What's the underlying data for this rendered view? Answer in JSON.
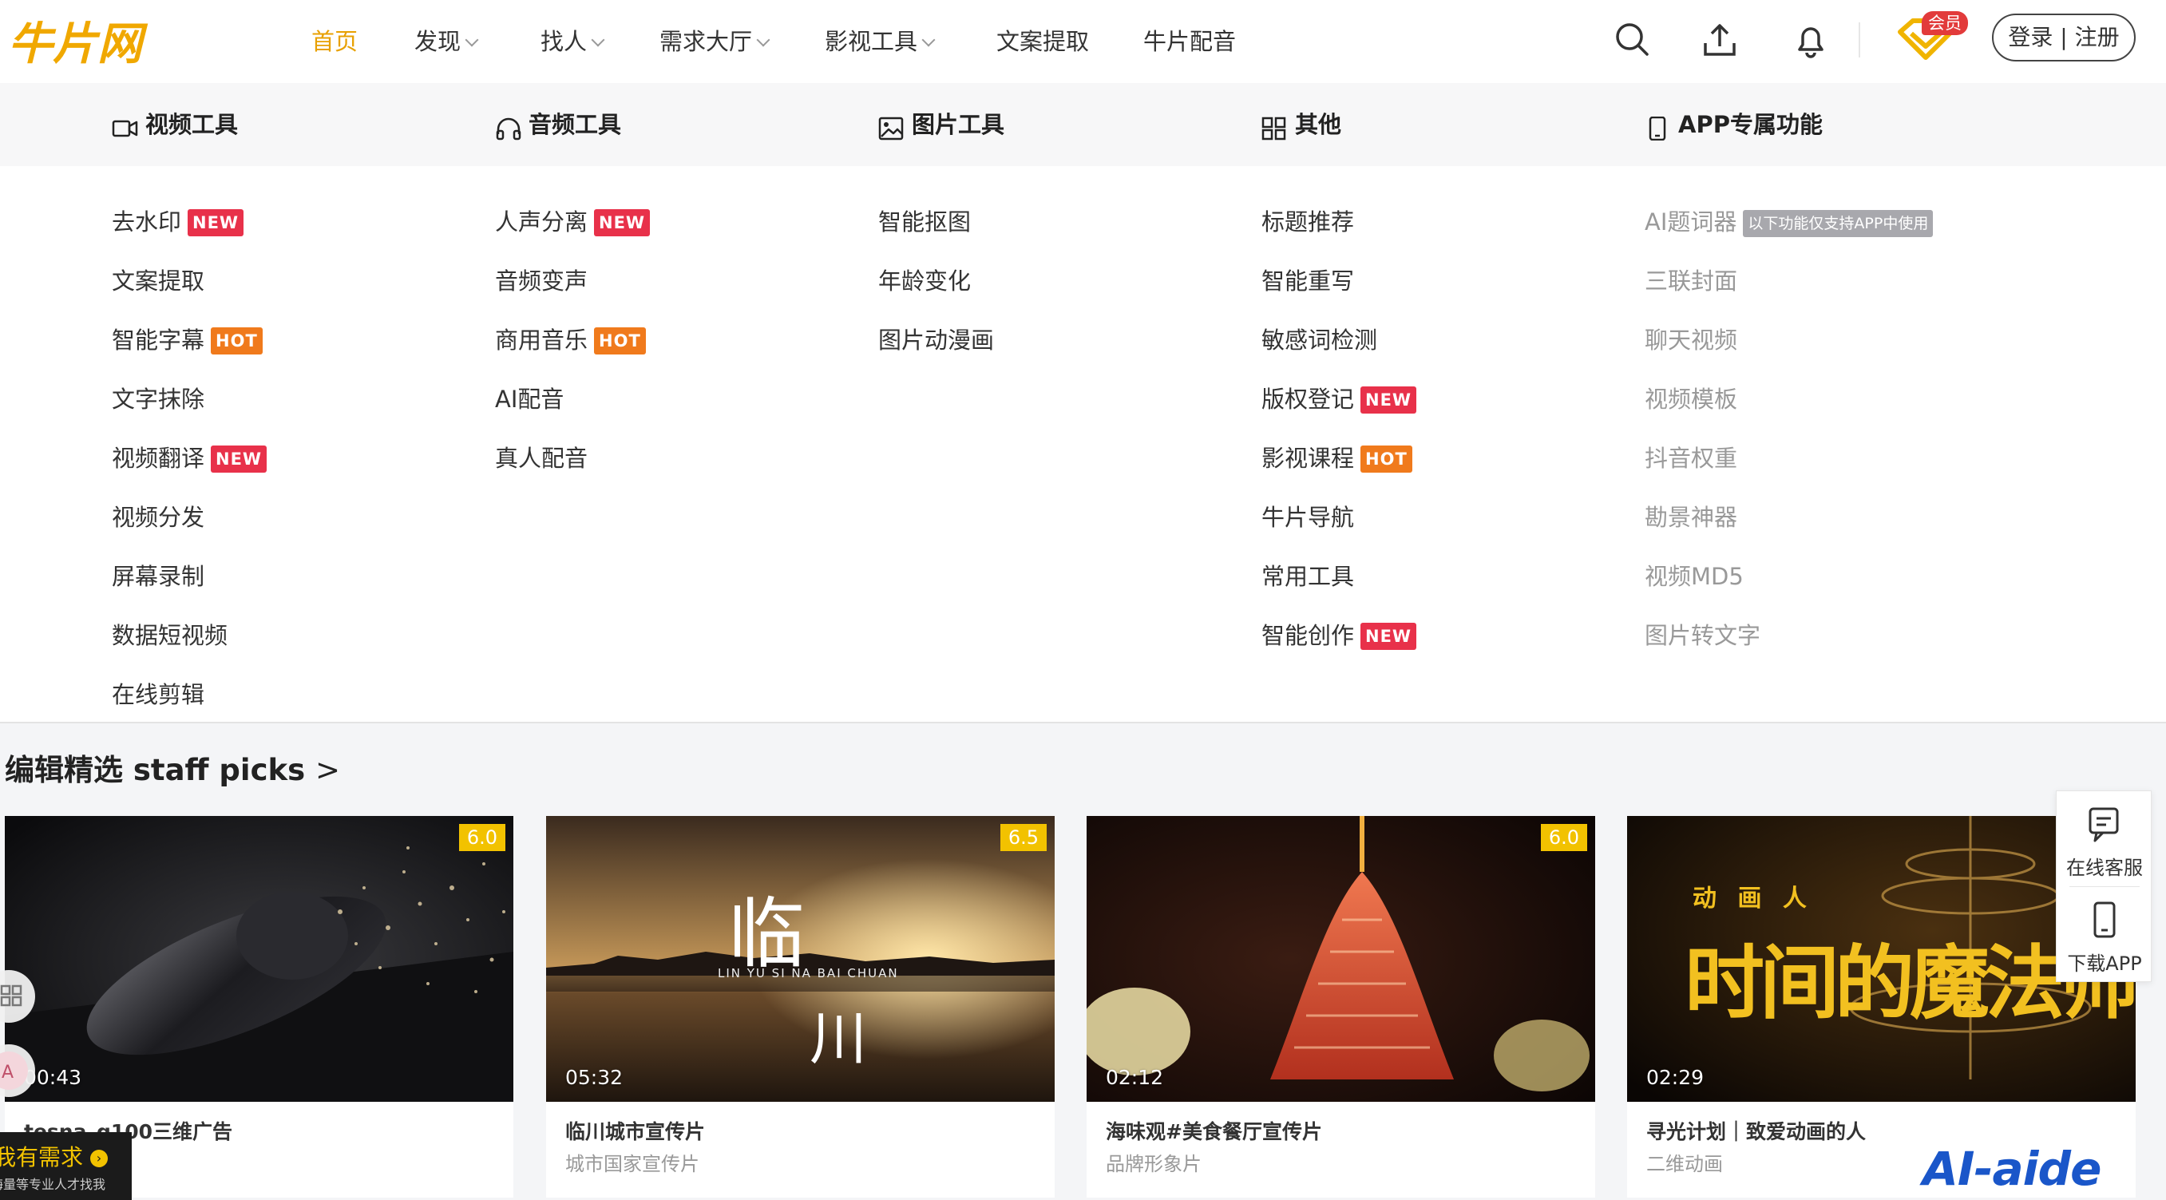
{
  "brand": {
    "logo_text": "牛片网",
    "accent": "#e8a000"
  },
  "nav": {
    "items": [
      {
        "label": "首页",
        "dropdown": false
      },
      {
        "label": "发现",
        "dropdown": true
      },
      {
        "label": "找人",
        "dropdown": true
      },
      {
        "label": "需求大厅",
        "dropdown": true
      },
      {
        "label": "影视工具",
        "dropdown": true
      },
      {
        "label": "文案提取",
        "dropdown": false
      },
      {
        "label": "牛片配音",
        "dropdown": false
      }
    ],
    "vip_badge": "会员",
    "login_label": "登录 | 注册"
  },
  "menu": {
    "columns": [
      {
        "title": "视频工具",
        "icon": "video-camera-icon",
        "items": [
          {
            "label": "去水印",
            "tag": "NEW"
          },
          {
            "label": "文案提取",
            "tag": ""
          },
          {
            "label": "智能字幕",
            "tag": "HOT"
          },
          {
            "label": "文字抹除",
            "tag": ""
          },
          {
            "label": "视频翻译",
            "tag": "NEW"
          },
          {
            "label": "视频分发",
            "tag": ""
          },
          {
            "label": "屏幕录制",
            "tag": ""
          },
          {
            "label": "数据短视频",
            "tag": ""
          },
          {
            "label": "在线剪辑",
            "tag": ""
          }
        ]
      },
      {
        "title": "音频工具",
        "icon": "headphones-icon",
        "items": [
          {
            "label": "人声分离",
            "tag": "NEW"
          },
          {
            "label": "音频变声",
            "tag": ""
          },
          {
            "label": "商用音乐",
            "tag": "HOT"
          },
          {
            "label": "AI配音",
            "tag": ""
          },
          {
            "label": "真人配音",
            "tag": ""
          }
        ]
      },
      {
        "title": "图片工具",
        "icon": "image-icon",
        "items": [
          {
            "label": "智能抠图",
            "tag": ""
          },
          {
            "label": "年龄变化",
            "tag": ""
          },
          {
            "label": "图片动漫画",
            "tag": ""
          }
        ]
      },
      {
        "title": "其他",
        "icon": "grid-icon",
        "items": [
          {
            "label": "标题推荐",
            "tag": ""
          },
          {
            "label": "智能重写",
            "tag": ""
          },
          {
            "label": "敏感词检测",
            "tag": ""
          },
          {
            "label": "版权登记",
            "tag": "NEW"
          },
          {
            "label": "影视课程",
            "tag": "HOT"
          },
          {
            "label": "牛片导航",
            "tag": ""
          },
          {
            "label": "常用工具",
            "tag": ""
          },
          {
            "label": "智能创作",
            "tag": "NEW"
          }
        ]
      },
      {
        "title": "APP专属功能",
        "icon": "phone-icon",
        "app_note": "以下功能仅支持APP中使用",
        "items": [
          {
            "label": "AI题词器",
            "tag": ""
          },
          {
            "label": "三联封面",
            "tag": ""
          },
          {
            "label": "聊天视频",
            "tag": ""
          },
          {
            "label": "视频模板",
            "tag": ""
          },
          {
            "label": "抖音权重",
            "tag": ""
          },
          {
            "label": "勘景神器",
            "tag": ""
          },
          {
            "label": "视频MD5",
            "tag": ""
          },
          {
            "label": "图片转文字",
            "tag": ""
          }
        ]
      }
    ]
  },
  "section": {
    "title": "编辑精选 staff picks",
    "more": ">"
  },
  "cards": [
    {
      "score": "6.0",
      "duration": "00:43",
      "title": "tesna_g100三维广告",
      "subtitle": ""
    },
    {
      "score": "6.5",
      "duration": "05:32",
      "title": "临川城市宣传片",
      "subtitle": "城市国家宣传片",
      "thumb_text": "临",
      "thumb_text2": "川",
      "thumb_caption": "LIN YU SI NA BAI CHUAN"
    },
    {
      "score": "6.0",
      "duration": "02:12",
      "title": "海味观#美食餐厅宣传片",
      "subtitle": "品牌形象片"
    },
    {
      "score": "",
      "duration": "02:29",
      "title": "寻光计划｜致爱动画的人",
      "subtitle": "二维动画",
      "thumb_text": "时间的魔法师",
      "thumb_kicker": "动 画 人"
    }
  ],
  "side": {
    "service_label": "在线客服",
    "app_label": "下载APP"
  },
  "demand": {
    "title": "我有需求",
    "subtitle": "海量等专业人才找我"
  },
  "watermark": "AI-aide"
}
